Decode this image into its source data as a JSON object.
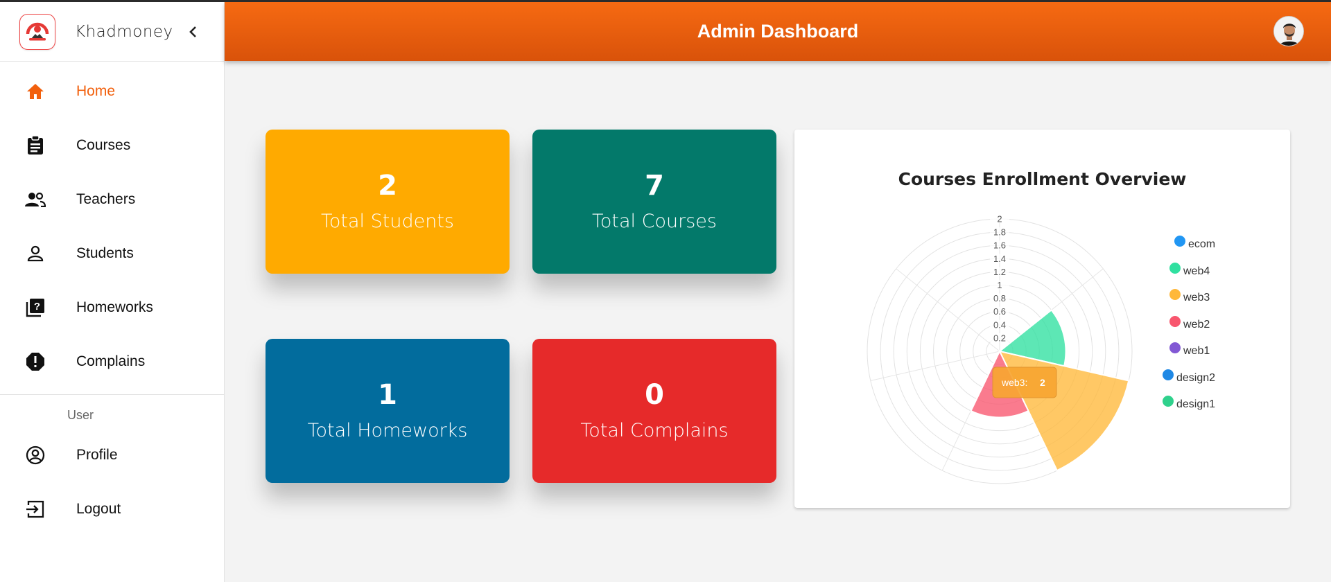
{
  "brand": {
    "name": "Khadmoney"
  },
  "header": {
    "title": "Admin Dashboard"
  },
  "nav": {
    "items": [
      {
        "label": "Home",
        "icon": "home-icon",
        "active": true
      },
      {
        "label": "Courses",
        "icon": "clipboard-icon"
      },
      {
        "label": "Teachers",
        "icon": "people-icon"
      },
      {
        "label": "Students",
        "icon": "person-icon"
      },
      {
        "label": "Homeworks",
        "icon": "question-library-icon"
      },
      {
        "label": "Complains",
        "icon": "report-icon"
      }
    ],
    "user_section": "User",
    "user_items": [
      {
        "label": "Profile",
        "icon": "account-circle-icon"
      },
      {
        "label": "Logout",
        "icon": "logout-icon"
      }
    ]
  },
  "stats": [
    {
      "value": "2",
      "label": "Total Students",
      "color": "#ffaa00"
    },
    {
      "value": "7",
      "label": "Total Courses",
      "color": "#03796a"
    },
    {
      "value": "1",
      "label": "Total Homeworks",
      "color": "#026c9d"
    },
    {
      "value": "0",
      "label": "Total Complains",
      "color": "#e62a2a"
    }
  ],
  "chart_data": {
    "type": "polarArea",
    "title": "Courses Enrollment Overview",
    "categories": [
      "ecom",
      "web4",
      "web3",
      "web2",
      "web1",
      "design2",
      "design1"
    ],
    "values": [
      0,
      1,
      2,
      1,
      0,
      0,
      0
    ],
    "colors": [
      "#2196f3",
      "#30e0a0",
      "#ffb83a",
      "#f8566e",
      "#8258d4",
      "#1e88e5",
      "#2fd18c"
    ],
    "r_ticks": [
      "0.2",
      "0.4",
      "0.6",
      "0.8",
      "1",
      "1.2",
      "1.4",
      "1.6",
      "1.8",
      "2"
    ],
    "r_max": 2,
    "legend_position": "right",
    "tooltip": {
      "label": "web3:",
      "value": "2"
    }
  },
  "colors": {
    "accent": "#f2600d"
  }
}
